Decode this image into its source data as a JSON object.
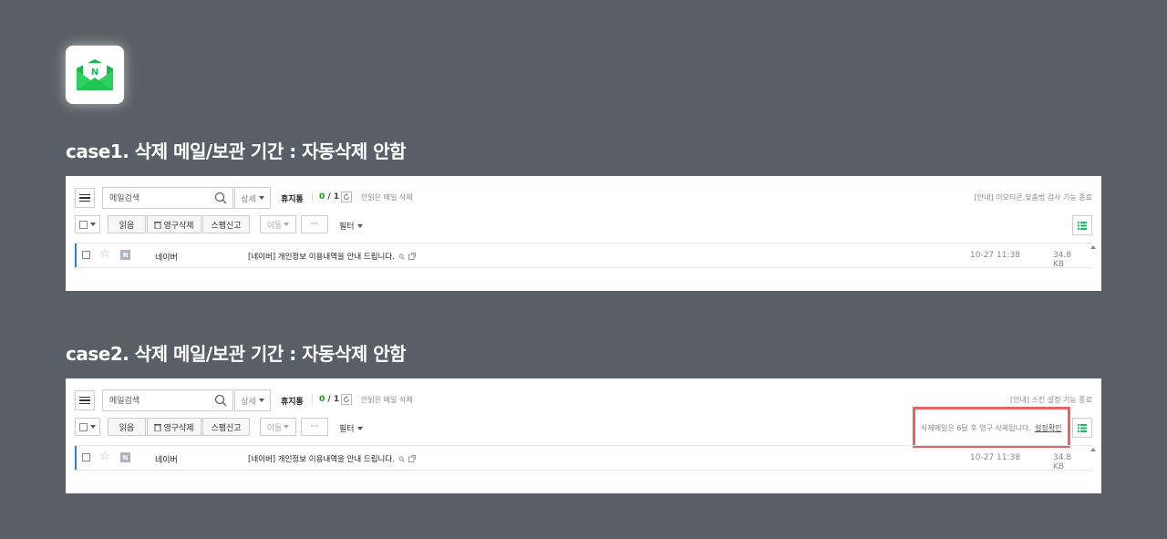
{
  "app": {
    "icon": "naver-mail-icon",
    "icon_letter": "N",
    "brand_color": "#03c75a"
  },
  "cases": [
    {
      "title": "case1. 삭제 메일/보관 기간 : 자동삭제 안함",
      "toolbar": {
        "search_placeholder": "메일검색",
        "detail_label": "상세",
        "folder_name": "휴지통",
        "unread_count": "0",
        "total_count": "1",
        "unread_delete_label": "안읽은 메일 삭제",
        "notice": "[안내] 이모티콘,맞춤법 검사 기능 종료",
        "read_label": "읽음",
        "permanent_delete_label": "영구삭제",
        "spam_report_label": "스팸신고",
        "move_label": "이동",
        "more_label": "···",
        "filter_label": "필터"
      },
      "mail": {
        "sender": "네이버",
        "badge": "N",
        "subject": "[네이버] 개인정보 이용내역을 안내 드립니다.",
        "date": "10-27 11:38",
        "size": "34.8 KB"
      }
    },
    {
      "title": "case2. 삭제 메일/보관 기간 : 자동삭제 안함",
      "toolbar": {
        "search_placeholder": "메일검색",
        "detail_label": "상세",
        "folder_name": "휴지통",
        "unread_count": "0",
        "total_count": "1",
        "unread_delete_label": "안읽은 메일 삭제",
        "notice": "[안내] 스킨 설정 기능 종료",
        "read_label": "읽음",
        "permanent_delete_label": "영구삭제",
        "spam_report_label": "스팸신고",
        "move_label": "이동",
        "more_label": "···",
        "filter_label": "필터"
      },
      "highlight": {
        "message": "삭제메일은 6달 후 영구 삭제됩니다.",
        "link": "설정확인",
        "border_color": "#e86464"
      },
      "mail": {
        "sender": "네이버",
        "badge": "N",
        "subject": "[네이버] 개인정보 이용내역을 안내 드립니다.",
        "date": "10-27 11:38",
        "size": "34.8 KB"
      }
    }
  ]
}
